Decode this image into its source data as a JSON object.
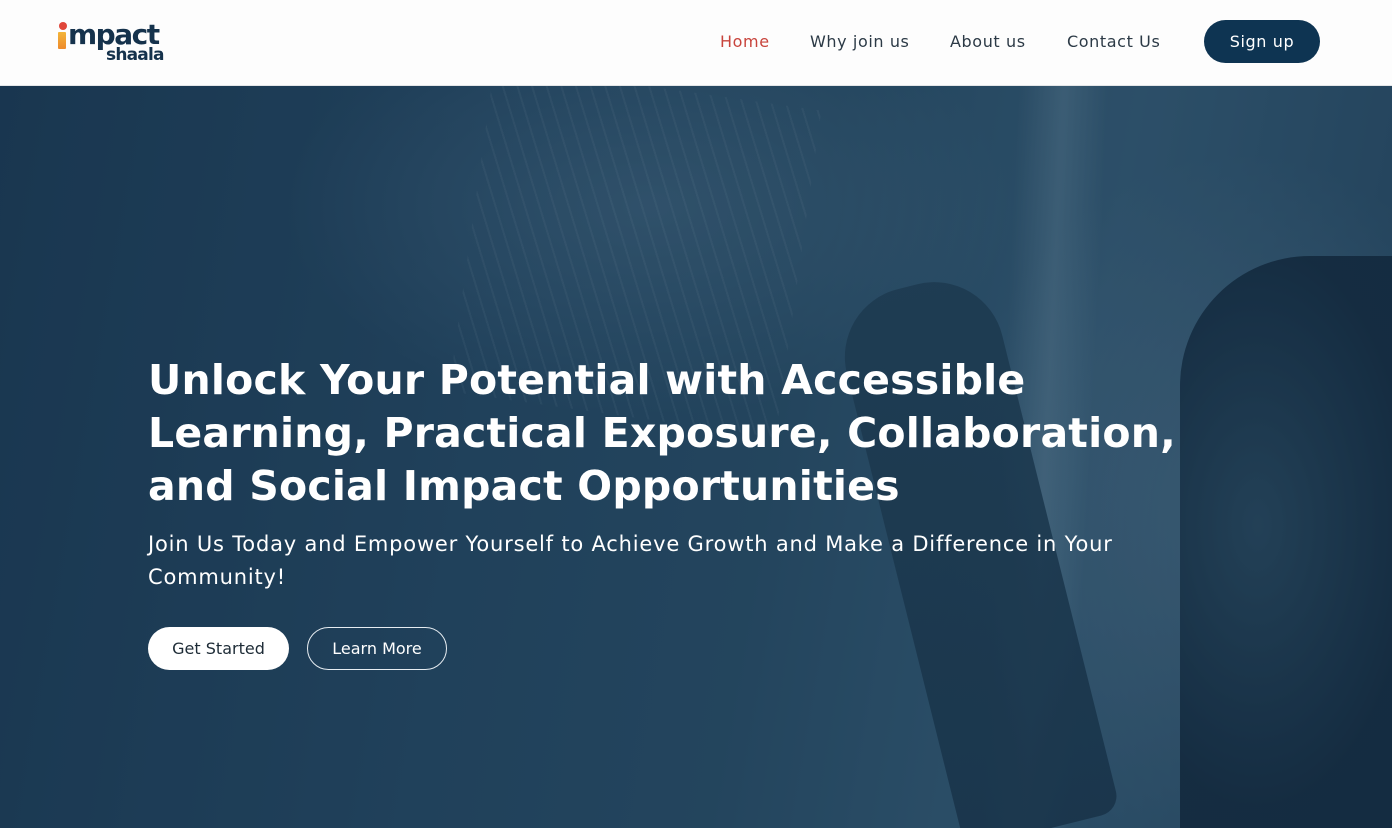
{
  "brand": {
    "logo_main": "mpact",
    "logo_sub": "shaala",
    "colors": {
      "navy": "#15324c",
      "red_dot": "#e0463a",
      "orange": "#f3b53a"
    }
  },
  "nav": {
    "items": [
      {
        "label": "Home",
        "active": true
      },
      {
        "label": "Why join us",
        "active": false
      },
      {
        "label": "About us",
        "active": false
      },
      {
        "label": "Contact Us",
        "active": false
      }
    ],
    "signup_label": "Sign up",
    "active_color": "#c8443c",
    "button_color": "#0e3452"
  },
  "hero": {
    "title": "Unlock Your Potential with Accessible Learning, Practical Exposure, Collaboration, and Social Impact Opportunities",
    "subtitle": "Join Us Today and Empower Yourself to Achieve Growth and Make a Difference in Your Community!",
    "primary_cta": "Get Started",
    "secondary_cta": "Learn More"
  }
}
